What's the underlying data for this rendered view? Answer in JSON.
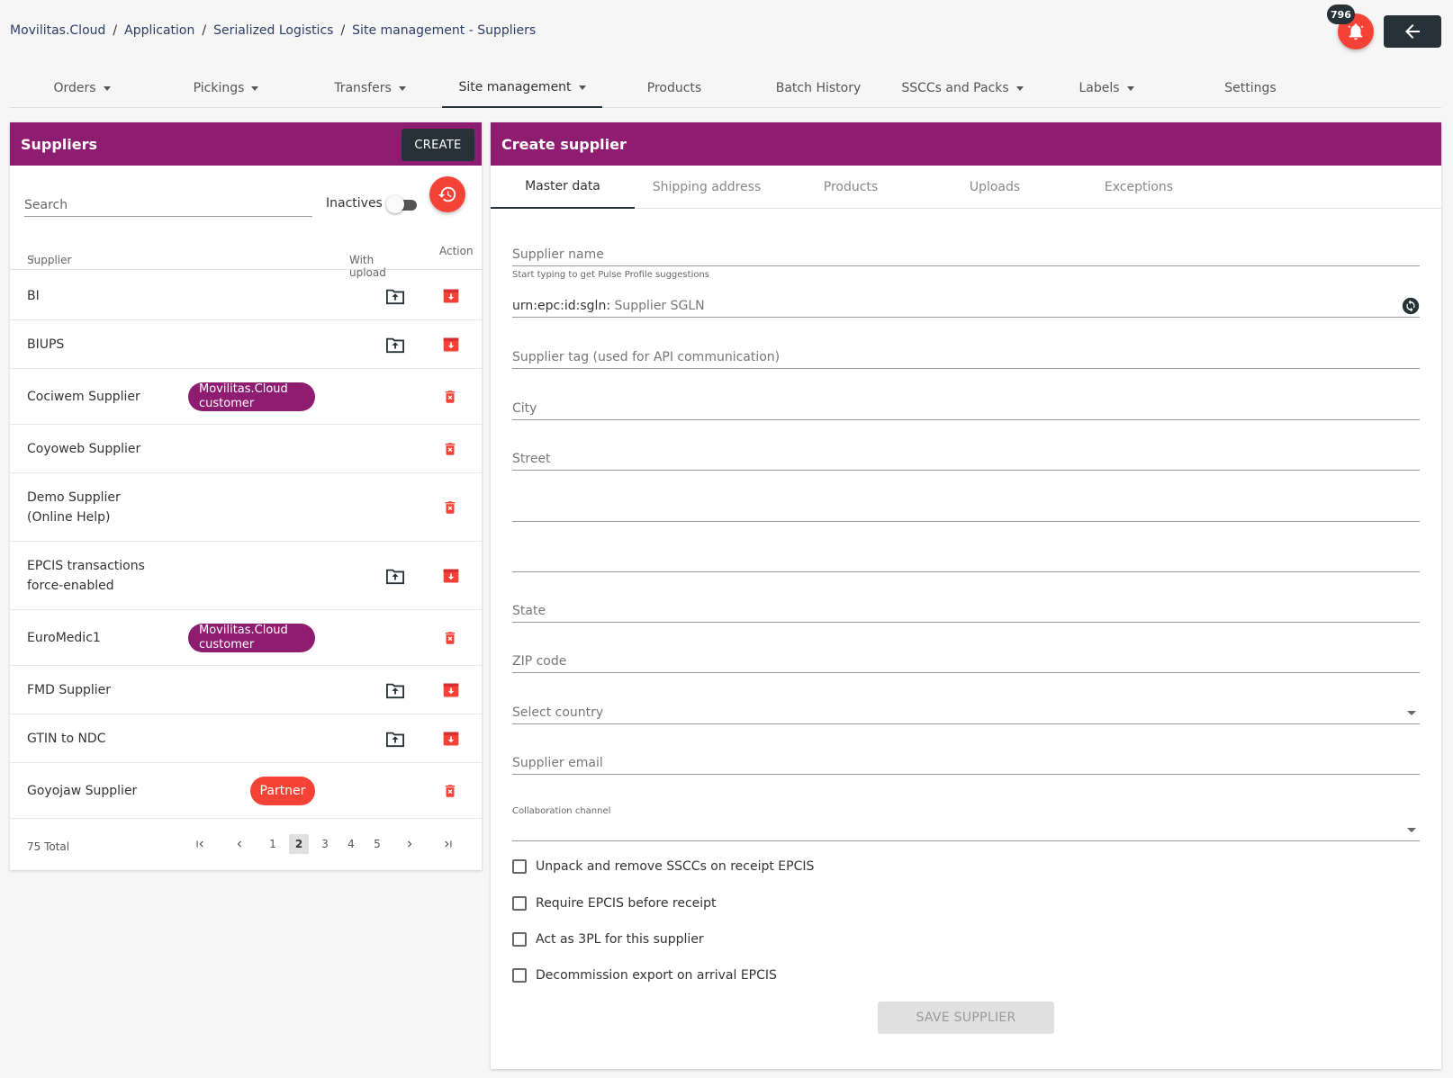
{
  "breadcrumb": [
    "Movilitas.Cloud",
    "Application",
    "Serialized Logistics",
    "Site management - Suppliers"
  ],
  "notifications": {
    "count": "796"
  },
  "nav": [
    {
      "label": "Orders",
      "dropdown": true
    },
    {
      "label": "Pickings",
      "dropdown": true
    },
    {
      "label": "Transfers",
      "dropdown": true
    },
    {
      "label": "Site management",
      "dropdown": true,
      "active": true
    },
    {
      "label": "Products",
      "dropdown": false
    },
    {
      "label": "Batch History",
      "dropdown": false
    },
    {
      "label": "SSCCs and Packs",
      "dropdown": true
    },
    {
      "label": "Labels",
      "dropdown": true
    },
    {
      "label": "Settings",
      "dropdown": false
    }
  ],
  "suppliers": {
    "title": "Suppliers",
    "create_label": "CREATE",
    "search_placeholder": "Search",
    "inactives_label": "Inactives",
    "columns": {
      "supplier": "Supplier",
      "with_upload": "With upload",
      "action": "Action"
    },
    "rows": [
      {
        "name": "BI",
        "upload": true,
        "chip": "",
        "deletable": false
      },
      {
        "name": "BIUPS",
        "upload": true,
        "chip": "",
        "deletable": false
      },
      {
        "name": "Cociwem Supplier",
        "upload": false,
        "chip": "Movilitas.Cloud customer",
        "chip_type": "cloud",
        "deletable": true
      },
      {
        "name": "Coyoweb Supplier",
        "upload": false,
        "chip": "",
        "deletable": true
      },
      {
        "name": "Demo Supplier (Online Help)",
        "upload": false,
        "chip": "",
        "deletable": true
      },
      {
        "name": "EPCIS transactions force-enabled",
        "upload": true,
        "chip": "",
        "deletable": false
      },
      {
        "name": "EuroMedic1",
        "upload": false,
        "chip": "Movilitas.Cloud customer",
        "chip_type": "cloud",
        "deletable": true
      },
      {
        "name": "FMD Supplier",
        "upload": true,
        "chip": "",
        "deletable": false
      },
      {
        "name": "GTIN to NDC",
        "upload": true,
        "chip": "",
        "deletable": false
      },
      {
        "name": "Goyojaw Supplier",
        "upload": false,
        "chip": "Partner",
        "chip_type": "partner",
        "deletable": true
      }
    ],
    "total": "75 Total",
    "pages": [
      "1",
      "2",
      "3",
      "4",
      "5"
    ],
    "current_page": "2"
  },
  "create_supplier": {
    "title": "Create supplier",
    "tabs": [
      "Master data",
      "Shipping address",
      "Products",
      "Uploads",
      "Exceptions"
    ],
    "active_tab": "Master data",
    "fields": {
      "supplier_name": "Supplier name",
      "supplier_name_hint": "Start typing to get Pulse Profile suggestions",
      "sgln_prefix": "urn:epc:id:sgln:",
      "sgln_placeholder": "Supplier SGLN",
      "supplier_tag": "Supplier tag (used for API communication)",
      "city": "City",
      "street": "Street",
      "street2": "",
      "street3": "",
      "state": "State",
      "zip": "ZIP code",
      "country": "Select country",
      "email": "Supplier email",
      "collaboration_channel": "Collaboration channel"
    },
    "checkboxes": [
      "Unpack and remove SSCCs on receipt EPCIS",
      "Require EPCIS before receipt",
      "Act as 3PL for this supplier",
      "Decommission export on arrival EPCIS"
    ],
    "save_label": "SAVE SUPPLIER"
  },
  "colors": {
    "header": "#8e1c70",
    "accent_red": "#f44336",
    "dark": "#263238"
  }
}
